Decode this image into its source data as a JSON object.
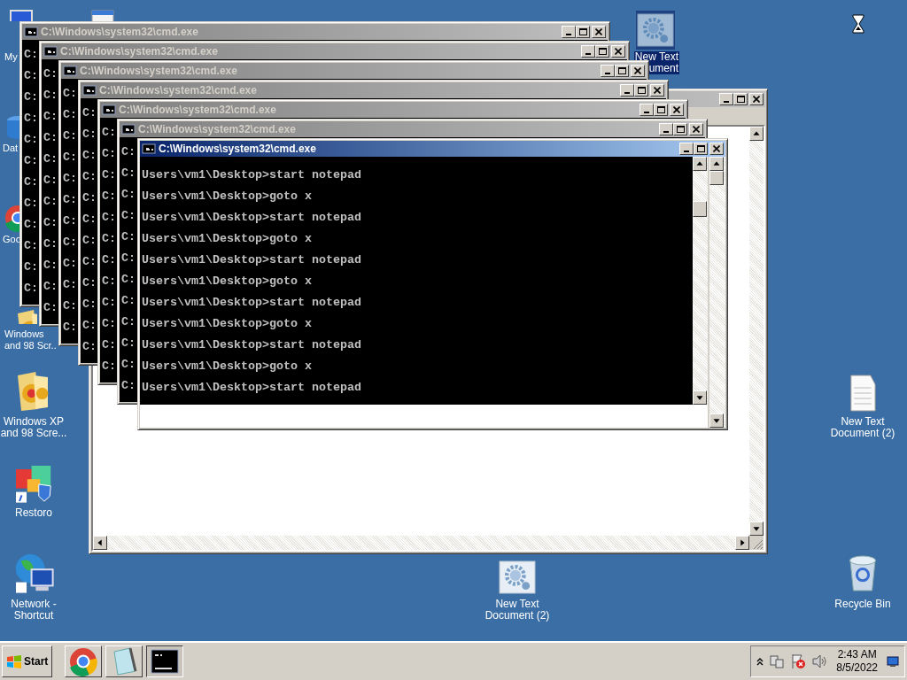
{
  "desktop_icons": [
    {
      "kind": "computer",
      "label": [
        "My"
      ],
      "selected": false
    },
    {
      "kind": "document",
      "selected": false
    },
    {
      "kind": "database",
      "label": [
        "Dat"
      ],
      "selected": false
    },
    {
      "kind": "chrome",
      "label": [
        "Goo"
      ],
      "selected": false
    },
    {
      "kind": "folder",
      "label": [
        "Windows",
        "and 98 Scr.."
      ],
      "selected": false
    },
    {
      "kind": "gear_document",
      "label": [
        "New Text",
        "ument"
      ],
      "selected": true
    },
    {
      "kind": "folder",
      "label": [
        "Windows XP",
        "and 98 Scre..."
      ],
      "selected": false
    },
    {
      "kind": "restoro",
      "label": [
        "Restoro"
      ],
      "selected": false
    },
    {
      "kind": "network",
      "label": [
        "Network -",
        "Shortcut"
      ],
      "selected": false
    },
    {
      "kind": "text_document",
      "label": [
        "New Text",
        "Document (2)"
      ],
      "selected": false
    },
    {
      "kind": "gear_document",
      "label": [
        "New Text",
        "Document (2)"
      ],
      "selected": false
    },
    {
      "kind": "recycle_bin",
      "label": [
        "Recycle Bin"
      ],
      "selected": false
    }
  ],
  "windows": [
    {
      "kind": "notepad",
      "active": false
    },
    {
      "kind": "cmd",
      "title": "C:\\Windows\\system32\\cmd.exe",
      "active": false,
      "lines": [
        "C:",
        "C:",
        "C:",
        "C:",
        "C:",
        "C:",
        "C:",
        "C:",
        "C:",
        "C:",
        "C:",
        "C:"
      ]
    },
    {
      "kind": "cmd",
      "title": "C:\\Windows\\system32\\cmd.exe",
      "active": false,
      "lines": [
        "C:",
        "C:",
        "C:",
        "C:",
        "C:",
        "C:",
        "C:",
        "C:",
        "C:",
        "C:",
        "C:",
        "C:"
      ]
    },
    {
      "kind": "cmd",
      "title": "C:\\Windows\\system32\\cmd.exe",
      "active": false,
      "lines": [
        "C:",
        "C:",
        "C:",
        "C:",
        "C:",
        "C:",
        "C:",
        "C:",
        "C:",
        "C:",
        "C:",
        "C:"
      ]
    },
    {
      "kind": "cmd",
      "title": "C:\\Windows\\system32\\cmd.exe",
      "active": false,
      "lines": [
        "C:",
        "C:",
        "C:",
        "C:",
        "C:",
        "C:",
        "C:",
        "C:",
        "C:",
        "C:",
        "C:",
        "C:"
      ]
    },
    {
      "kind": "cmd",
      "title": "C:\\Windows\\system32\\cmd.exe",
      "active": false,
      "lines": [
        "C:",
        "C:",
        "C:",
        "C:",
        "C:",
        "C:",
        "C:",
        "C:",
        "C:",
        "C:",
        "C:",
        "C:"
      ]
    },
    {
      "kind": "cmd",
      "title": "C:\\Windows\\system32\\cmd.exe",
      "active": false,
      "lines": [
        "C:",
        "C:",
        "C:",
        "C:",
        "C:",
        "C:",
        "C:",
        "C:",
        "C:",
        "C:",
        "C:",
        "C:"
      ]
    },
    {
      "kind": "cmd",
      "title": "C:\\Windows\\system32\\cmd.exe",
      "active": true,
      "lines": [
        "Users\\vm1\\Desktop>start notepad",
        "Users\\vm1\\Desktop>goto x",
        "Users\\vm1\\Desktop>start notepad",
        "Users\\vm1\\Desktop>goto x",
        "Users\\vm1\\Desktop>start notepad",
        "Users\\vm1\\Desktop>goto x",
        "Users\\vm1\\Desktop>start notepad",
        "Users\\vm1\\Desktop>goto x",
        "Users\\vm1\\Desktop>start notepad",
        "Users\\vm1\\Desktop>goto x",
        "Users\\vm1\\Desktop>start notepad"
      ]
    }
  ],
  "taskbar": {
    "start": "Start",
    "buttons": [
      {
        "kind": "chrome",
        "selected": false
      },
      {
        "kind": "notepad",
        "selected": false
      },
      {
        "kind": "cmd",
        "selected": true
      }
    ],
    "clock": {
      "time": "2:43 AM",
      "date": "8/5/2022"
    }
  }
}
